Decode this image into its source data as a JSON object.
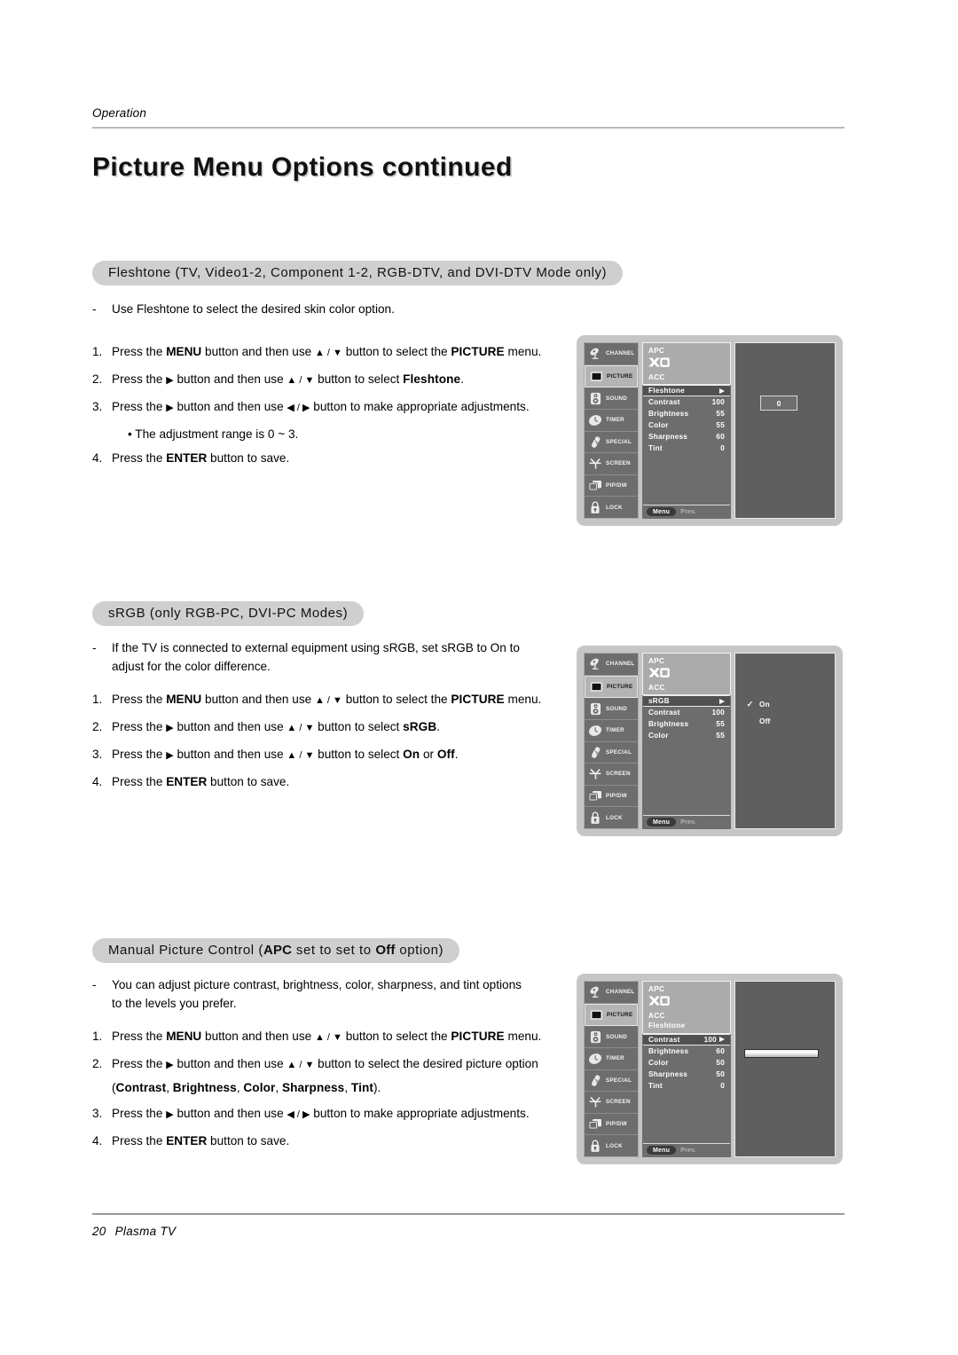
{
  "header": {
    "running_head": "Operation",
    "page_title": "Picture Menu Options continued"
  },
  "footer": {
    "page_number": "20",
    "product": "Plasma TV"
  },
  "sections": [
    {
      "heading_plain": "Fleshtone (TV, Video1-2, Component 1-2, RGB-DTV, and DVI-DTV Mode only)",
      "heading_pre": "Fleshtone (TV, Video1-2, Component 1-2, RGB-DTV, and DVI-DTV Mode only)",
      "intro": "Use Fleshtone to select the desired skin color option.",
      "steps": [
        {
          "num": "1.",
          "text_1": "Press the ",
          "bold_1": "MENU",
          "text_2": " button and then use ▲ / ▼ button to select the ",
          "bold_2": "PICTURE",
          "text_3": " menu."
        },
        {
          "num": "2.",
          "text_1": "Press the ▶ button and then use ▲ / ▼ button to select ",
          "bold_1": "Fleshtone",
          "text_2": "."
        },
        {
          "num": "3.",
          "text_1": "Press the ▶ button and then use ◀ / ▶ button to make appropriate adjustments."
        },
        {
          "bullet": "• The adjustment range is 0 ~ 3."
        },
        {
          "num": "4.",
          "text_1": "Press the ",
          "bold_1": "ENTER",
          "text_2": " button to save."
        }
      ]
    },
    {
      "heading_plain": "sRGB (only RGB-PC, DVI-PC Modes)",
      "intro": "If the TV is connected to external equipment using sRGB, set sRGB to On to adjust for the color difference.",
      "steps": [
        {
          "num": "1.",
          "text_1": "Press the ",
          "bold_1": "MENU",
          "text_2": " button and then use ▲ / ▼ button to select the ",
          "bold_2": "PICTURE",
          "text_3": " menu."
        },
        {
          "num": "2.",
          "text_1": "Press the ▶ button and then use ▲ / ▼ button to select ",
          "bold_1": "sRGB",
          "text_2": "."
        },
        {
          "num": "3.",
          "text_1": "Press the ▶ button and then use ▲ / ▼ button to select ",
          "bold_1": "On",
          "text_2": " or ",
          "bold_2": "Off",
          "text_3": "."
        },
        {
          "num": "4.",
          "text_1": "Press the ",
          "bold_1": "ENTER",
          "text_2": " button to save."
        }
      ]
    },
    {
      "heading_plain": "Manual Picture Control (APC set to set to Off option)",
      "intro": "You can adjust picture contrast, brightness, color, sharpness, and tint options to the levels you prefer.",
      "steps": [
        {
          "num": "1.",
          "text_1": "Press the ",
          "bold_1": "MENU",
          "text_2": " button and then use ▲ / ▼ button to select the ",
          "bold_2": "PICTURE",
          "text_3": " menu."
        },
        {
          "num": "2.",
          "text_1": "Press the ▶ button and then use ▲ / ▼ button to select the desired picture option"
        },
        {
          "num": "3.",
          "text_1": "Press the ▶ button and then use ◀ / ▶ button to make appropriate adjustments."
        },
        {
          "num": "4.",
          "text_1": "Press the ",
          "bold_1": "ENTER",
          "text_2": " button to save."
        }
      ]
    }
  ],
  "section1": {
    "heading": "Fleshtone (TV, Video1-2, Component 1-2, RGB-DTV, and DVI-DTV Mode only)",
    "intro": "Use Fleshtone to select the desired skin color option.",
    "s1_a": "Press the ",
    "s1_menu": "MENU",
    "s1_b": " button and then use ",
    "s1_updown": "▲ / ▼",
    "s1_c": " button to select the ",
    "s1_picture": "PICTURE",
    "s1_d": " menu.",
    "s2_a": "Press the ",
    "s2_right": "▶",
    "s2_b": " button and then use ",
    "s2_updown": "▲ / ▼",
    "s2_c": " button to select ",
    "s2_target": "Fleshtone",
    "s2_d": ".",
    "s3_a": "Press the ",
    "s3_right": "▶",
    "s3_b": " button and then use ",
    "s3_lr": "◀ / ▶",
    "s3_c": " button to make appropriate adjustments.",
    "bullet": "• The adjustment range is 0 ~ 3.",
    "s4_a": "Press the ",
    "s4_enter": "ENTER",
    "s4_b": " button to save.",
    "n1": "1.",
    "n2": "2.",
    "n3": "3.",
    "n4": "4."
  },
  "section2": {
    "heading": "sRGB (only RGB-PC, DVI-PC Modes)",
    "intro_l1": "If the TV is connected to external equipment using sRGB, set sRGB to On to",
    "intro_l2": "adjust for the color difference.",
    "s1_a": "Press the ",
    "s1_menu": "MENU",
    "s1_b": " button and then use ",
    "s1_updown": "▲ / ▼",
    "s1_c": " button to select the ",
    "s1_picture": "PICTURE",
    "s1_d": " menu.",
    "s2_a": "Press the ",
    "s2_right": "▶",
    "s2_b": " button and then use ",
    "s2_updown": "▲ / ▼",
    "s2_c": " button to select ",
    "s2_target": "sRGB",
    "s2_d": ".",
    "s3_a": "Press the ",
    "s3_right": "▶",
    "s3_b": " button and then use ",
    "s3_updown": "▲ / ▼",
    "s3_c": " button to select ",
    "s3_on": "On",
    "s3_or": " or ",
    "s3_off": "Off",
    "s3_d": ".",
    "s4_a": "Press the ",
    "s4_enter": "ENTER",
    "s4_b": " button to save.",
    "n1": "1.",
    "n2": "2.",
    "n3": "3.",
    "n4": "4."
  },
  "section3": {
    "heading_a": "Manual Picture Control (",
    "heading_apc": "APC",
    "heading_b": " set to set to ",
    "heading_off": "Off",
    "heading_c": " option)",
    "intro_l1": "You can adjust picture contrast, brightness, color, sharpness, and tint options",
    "intro_l2": "to the levels you prefer.",
    "s1_a": "Press the ",
    "s1_menu": "MENU",
    "s1_b": " button and then use ",
    "s1_updown": "▲ / ▼",
    "s1_c": " button to select the ",
    "s1_picture": "PICTURE",
    "s1_d": " menu.",
    "s2_a": "Press the ",
    "s2_right": "▶",
    "s2_b": " button and then use ",
    "s2_updown": "▲ / ▼",
    "s2_c": " button to select the desired picture option",
    "s2_l2_open": "(",
    "s2_opt1": "Contrast",
    "s2_sep1": ", ",
    "s2_opt2": "Brightness",
    "s2_sep2": ", ",
    "s2_opt3": "Color",
    "s2_sep3": ", ",
    "s2_opt4": "Sharpness",
    "s2_sep4": ", ",
    "s2_opt5": "Tint",
    "s2_l2_close": ").",
    "s3_a": "Press the ",
    "s3_right": "▶",
    "s3_b": " button and then use ",
    "s3_lr": "◀ / ▶",
    "s3_c": " button to make appropriate adjustments.",
    "s4_a": "Press the ",
    "s4_enter": "ENTER",
    "s4_b": " button to save.",
    "n1": "1.",
    "n2": "2.",
    "n3": "3.",
    "n4": "4."
  },
  "osd_common": {
    "rail": [
      {
        "label": "CHANNEL",
        "icon": "satellite-dish-icon",
        "selected": false
      },
      {
        "label": "PICTURE",
        "icon": "tv-screen-icon",
        "selected": true
      },
      {
        "label": "SOUND",
        "icon": "speaker-icon",
        "selected": false
      },
      {
        "label": "TIMER",
        "icon": "clock-icon",
        "selected": false
      },
      {
        "label": "SPECIAL",
        "icon": "remote-control-icon",
        "selected": false
      },
      {
        "label": "SCREEN",
        "icon": "antenna-icon",
        "selected": false
      },
      {
        "label": "PIP/DW",
        "icon": "pip-windows-icon",
        "selected": false
      },
      {
        "label": "LOCK",
        "icon": "padlock-icon",
        "selected": false
      }
    ],
    "group_top": {
      "apc": "APC",
      "xd": "XD",
      "acc": "ACC"
    },
    "footer": {
      "menu": "Menu",
      "prev": "Prev."
    }
  },
  "osd1": {
    "rows": [
      {
        "label": "Fleshtone",
        "value": "",
        "highlight": true,
        "arrow": true
      },
      {
        "label": "Contrast",
        "value": "100",
        "highlight": false,
        "arrow": false
      },
      {
        "label": "Brightness",
        "value": "55",
        "highlight": false,
        "arrow": false
      },
      {
        "label": "Color",
        "value": "55",
        "highlight": false,
        "arrow": false
      },
      {
        "label": "Sharpness",
        "value": "60",
        "highlight": false,
        "arrow": false
      },
      {
        "label": "Tint",
        "value": "0",
        "highlight": false,
        "arrow": false
      }
    ],
    "value_box": "0"
  },
  "osd2": {
    "rows": [
      {
        "label": "sRGB",
        "value": "",
        "highlight": true,
        "arrow": true
      },
      {
        "label": "Contrast",
        "value": "100",
        "highlight": false,
        "arrow": false
      },
      {
        "label": "Brightness",
        "value": "55",
        "highlight": false,
        "arrow": false
      },
      {
        "label": "Color",
        "value": "55",
        "highlight": false,
        "arrow": false
      }
    ],
    "options": [
      {
        "label": "On",
        "checked": "✓"
      },
      {
        "label": "Off",
        "checked": ""
      }
    ]
  },
  "osd3": {
    "top_extra": "Fleshtone",
    "rows": [
      {
        "label": "Contrast",
        "value": "100",
        "highlight": true,
        "arrow": true
      },
      {
        "label": "Brightness",
        "value": "60",
        "highlight": false,
        "arrow": false
      },
      {
        "label": "Color",
        "value": "50",
        "highlight": false,
        "arrow": false
      },
      {
        "label": "Sharpness",
        "value": "50",
        "highlight": false,
        "arrow": false
      },
      {
        "label": "Tint",
        "value": "0",
        "highlight": false,
        "arrow": false
      }
    ],
    "slider_fill_percent": 100
  }
}
